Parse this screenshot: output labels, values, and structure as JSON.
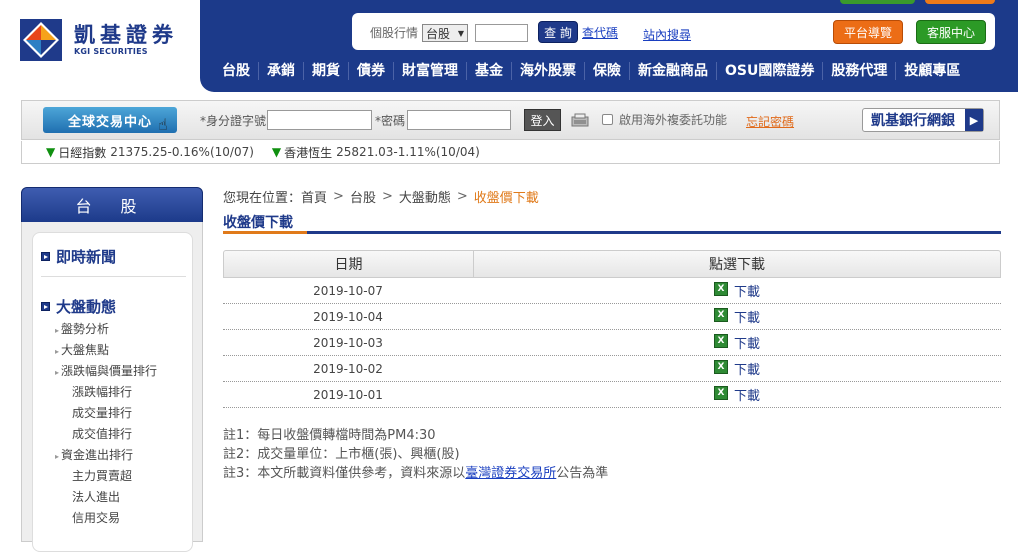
{
  "logo": {
    "cn": "凱基證券",
    "en": "KGI SECURITIES"
  },
  "header": {
    "stock_label": "個股行情",
    "market_value": "台股",
    "query_label": "查 詢",
    "lookup_label": "查代碼",
    "site_search": "站內搜尋",
    "platform_label": "平台導覽",
    "service_label": "客服中心"
  },
  "menu": [
    "台股",
    "承銷",
    "期貨",
    "債券",
    "財富管理",
    "基金",
    "海外股票",
    "保險",
    "新金融商品",
    "OSU國際證券",
    "股務代理",
    "投顧專區"
  ],
  "tradebar": {
    "global_label": "全球交易中心",
    "id_label": "*身分證字號",
    "pw_label": "*密碼",
    "login_label": "登入",
    "overseas_label": "啟用海外複委託功能",
    "forgot_label": "忘記密碼",
    "bank_label": "凱基銀行網銀"
  },
  "ticker": [
    {
      "name": "日經指數",
      "value": "21375.25-0.16%(10/07)"
    },
    {
      "name": "香港恆生",
      "value": "25821.03-1.11%(10/04)"
    }
  ],
  "sidebar": {
    "title": "台 股",
    "sec_news": "即時新聞",
    "sec_market": "大盤動態",
    "items": [
      "盤勢分析",
      "大盤焦點",
      "漲跌幅與價量排行",
      "漲跌幅排行",
      "成交量排行",
      "成交值排行",
      "資金進出排行",
      "主力買賣超",
      "法人進出",
      "信用交易"
    ]
  },
  "breadcrumb": {
    "prefix": "您現在位置：",
    "home": "首頁",
    "l1": "台股",
    "l2": "大盤動態",
    "current": "收盤價下載"
  },
  "page_title": "收盤價下載",
  "table": {
    "col_date": "日期",
    "col_download": "點選下載",
    "download_label": "下載",
    "rows": [
      "2019-10-07",
      "2019-10-04",
      "2019-10-03",
      "2019-10-02",
      "2019-10-01"
    ]
  },
  "notes": {
    "n1": "註1：每日收盤價轉檔時間為PM4:30",
    "n2": "註2：成交量單位：上市櫃(張)、興櫃(股)",
    "n3_pre": "註3：本文所載資料僅供參考，資料來源以",
    "n3_link": "臺灣證券交易所",
    "n3_post": "公告為準"
  },
  "colors": {
    "brand_blue": "#1c3a8a",
    "accent_orange": "#e07a1a",
    "green": "#2c9a26"
  }
}
